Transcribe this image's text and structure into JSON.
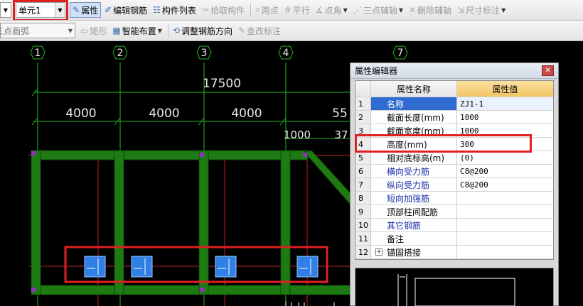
{
  "toolbar1": {
    "unit_value": "单元1",
    "items": [
      {
        "label": "属性",
        "icon": "properties-icon",
        "active": true
      },
      {
        "label": "编辑钢筋",
        "icon": "edit-rebar-icon"
      },
      {
        "label": "构件列表",
        "icon": "component-list-icon"
      },
      {
        "label": "拾取构件",
        "icon": "pick-component-icon",
        "disabled": true
      },
      {
        "label": "两点",
        "icon": "two-point-icon",
        "disabled": true
      },
      {
        "label": "平行",
        "icon": "parallel-icon",
        "disabled": true
      },
      {
        "label": "点角",
        "icon": "point-angle-icon",
        "disabled": true
      },
      {
        "label": "三点辅轴",
        "icon": "three-point-axis-icon",
        "disabled": true
      },
      {
        "label": "删除辅轴",
        "icon": "delete-axis-icon",
        "disabled": true
      },
      {
        "label": "尺寸标注",
        "icon": "dimension-icon",
        "disabled": true
      }
    ]
  },
  "toolbar2": {
    "arc_value": "三点画弧",
    "items": [
      {
        "label": "矩形",
        "icon": "rectangle-icon",
        "disabled": true
      },
      {
        "label": "智能布置",
        "icon": "smart-layout-icon"
      },
      {
        "label": "调整钢筋方向",
        "icon": "adjust-rebar-icon"
      },
      {
        "label": "查改标注",
        "icon": "edit-annotation-icon",
        "disabled": true
      }
    ]
  },
  "drawing": {
    "axes": [
      "1",
      "2",
      "3",
      "4",
      "7"
    ],
    "dim_total": "17500",
    "dim_spans": [
      "4000",
      "4000",
      "4000",
      "55"
    ],
    "dim_small": [
      "1000",
      "37"
    ]
  },
  "property_editor": {
    "title": "属性编辑器",
    "col_name": "属性名称",
    "col_value": "属性值",
    "rows": [
      {
        "num": "1",
        "name": "名称",
        "value": "ZJ1-1",
        "blue": true,
        "selected": true
      },
      {
        "num": "2",
        "name": "截面长度(mm)",
        "value": "1000",
        "blue": false
      },
      {
        "num": "3",
        "name": "截面宽度(mm)",
        "value": "1000",
        "blue": false
      },
      {
        "num": "4",
        "name": "高度(mm)",
        "value": "300",
        "blue": false
      },
      {
        "num": "5",
        "name": "相对底标高(m)",
        "value": "(0)",
        "blue": false
      },
      {
        "num": "6",
        "name": "横向受力筋",
        "value": "C8@200",
        "blue": true
      },
      {
        "num": "7",
        "name": "纵向受力筋",
        "value": "C8@200",
        "blue": true
      },
      {
        "num": "8",
        "name": "短向加强筋",
        "value": "",
        "blue": true
      },
      {
        "num": "9",
        "name": "顶部柱间配筋",
        "value": "",
        "blue": false
      },
      {
        "num": "10",
        "name": "其它钢筋",
        "value": "",
        "blue": true
      },
      {
        "num": "11",
        "name": "备注",
        "value": "",
        "blue": false
      },
      {
        "num": "12",
        "name": "锚固搭接",
        "value": "",
        "blue": false,
        "expandable": true
      }
    ]
  },
  "colors": {
    "beam": "#1e7a12",
    "grid": "#1fb81f",
    "highlight": "#e02020",
    "footing": "#2f7fe6"
  }
}
